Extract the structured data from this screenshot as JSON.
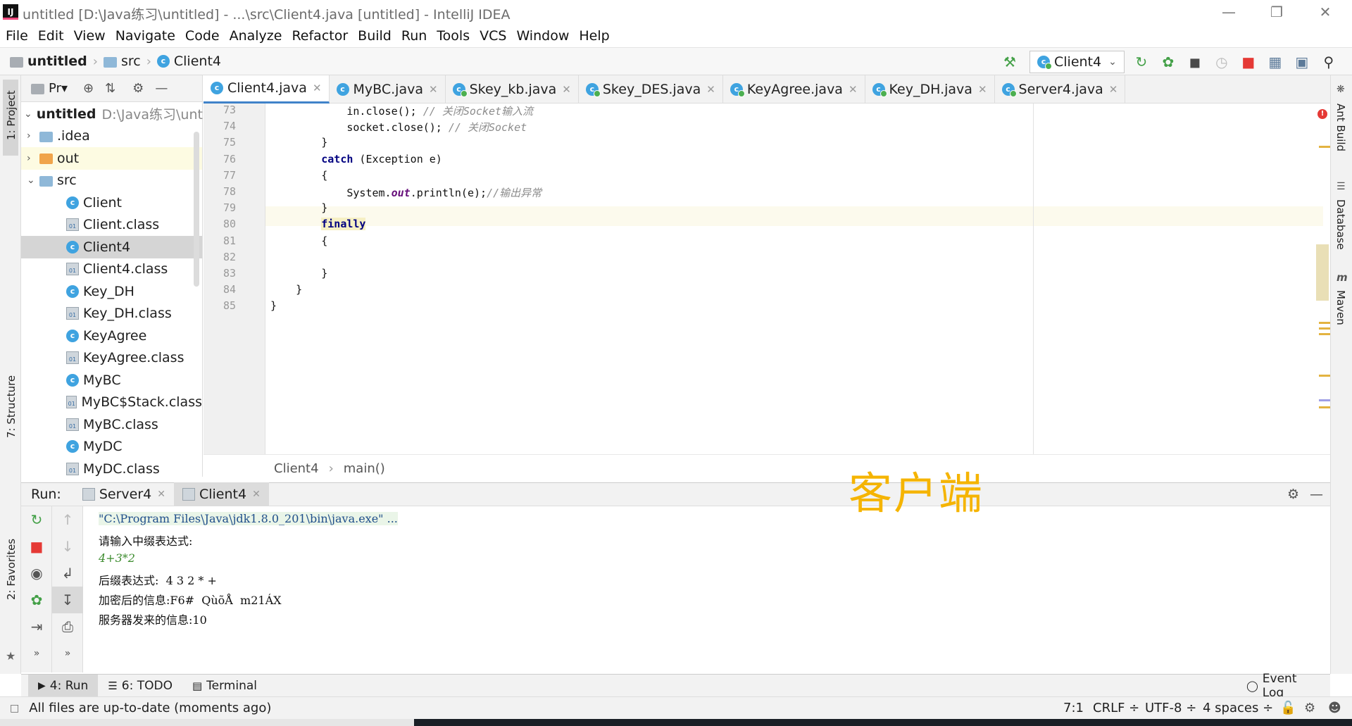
{
  "window": {
    "title": "untitled [D:\\Java练习\\untitled] - ...\\src\\Client4.java [untitled] - IntelliJ IDEA",
    "logo": "IJ"
  },
  "menu": [
    "File",
    "Edit",
    "View",
    "Navigate",
    "Code",
    "Analyze",
    "Refactor",
    "Build",
    "Run",
    "Tools",
    "VCS",
    "Window",
    "Help"
  ],
  "navbar": {
    "crumbs": [
      "untitled",
      "src",
      "Client4"
    ],
    "run_config": "Client4"
  },
  "left_stripe": {
    "project": "1: Project",
    "structure": "7: Structure",
    "favorites": "2: Favorites"
  },
  "right_stripe": {
    "ant": "Ant Build",
    "database": "Database",
    "maven": "Maven"
  },
  "project_panel": {
    "header": "Pr▾",
    "root": {
      "name": "untitled",
      "path": "D:\\Java练习\\untitl"
    },
    "items": [
      {
        "label": ".idea",
        "kind": "folder",
        "level": 1,
        "arrow": "›"
      },
      {
        "label": "out",
        "kind": "folder-orange",
        "level": 1,
        "arrow": "›"
      },
      {
        "label": "src",
        "kind": "folder",
        "level": 1,
        "arrow": "⌄"
      },
      {
        "label": "Client",
        "kind": "class",
        "level": 2
      },
      {
        "label": "Client.class",
        "kind": "classfile",
        "level": 2
      },
      {
        "label": "Client4",
        "kind": "class",
        "level": 2
      },
      {
        "label": "Client4.class",
        "kind": "classfile",
        "level": 2
      },
      {
        "label": "Key_DH",
        "kind": "class",
        "level": 2
      },
      {
        "label": "Key_DH.class",
        "kind": "classfile",
        "level": 2
      },
      {
        "label": "KeyAgree",
        "kind": "class",
        "level": 2
      },
      {
        "label": "KeyAgree.class",
        "kind": "classfile",
        "level": 2
      },
      {
        "label": "MyBC",
        "kind": "class",
        "level": 2
      },
      {
        "label": "MyBC$Stack.class",
        "kind": "classfile",
        "level": 2
      },
      {
        "label": "MyBC.class",
        "kind": "classfile",
        "level": 2
      },
      {
        "label": "MyDC",
        "kind": "class",
        "level": 2
      },
      {
        "label": "MyDC.class",
        "kind": "classfile",
        "level": 2
      }
    ]
  },
  "editor_tabs": [
    "Client4.java",
    "MyBC.java",
    "Skey_kb.java",
    "Skey_DES.java",
    "KeyAgree.java",
    "Key_DH.java",
    "Server4.java"
  ],
  "editor": {
    "lines": [
      {
        "n": "73",
        "code": "            in.close(); ",
        "comment": "// 关闭Socket输入流"
      },
      {
        "n": "74",
        "code": "            socket.close(); ",
        "comment": "// 关闭Socket"
      },
      {
        "n": "75",
        "code": "        }"
      },
      {
        "n": "76",
        "kw": "catch",
        "code": " (Exception e)"
      },
      {
        "n": "77",
        "code": "        {"
      },
      {
        "n": "78",
        "code": "            System.",
        "field": "out",
        "code2": ".println(e);",
        "comment": "//输出异常"
      },
      {
        "n": "79",
        "code": "        }"
      },
      {
        "n": "80",
        "kw": "finally",
        "code": ""
      },
      {
        "n": "81",
        "code": "        {"
      },
      {
        "n": "82",
        "code": ""
      },
      {
        "n": "83",
        "code": "        }"
      },
      {
        "n": "84",
        "code": "    }"
      },
      {
        "n": "85",
        "code": "}"
      }
    ],
    "breadcrumb": [
      "Client4",
      "main()"
    ]
  },
  "run_panel": {
    "label": "Run:",
    "tabs": [
      "Server4",
      "Client4"
    ],
    "console": [
      "\"C:\\Program Files\\Java\\jdk1.8.0_201\\bin\\java.exe\" ...",
      "请输入中缀表达式:",
      "4+3*2",
      "后缀表达式:  4 3 2 * +",
      "加密后的信息:F6#  QùõÅ  m21ÁX",
      "服务器发来的信息:10"
    ]
  },
  "overlay_label": "客户端",
  "tool_buttons": [
    "4: Run",
    "6: TODO",
    "Terminal"
  ],
  "event_log": "Event Log",
  "status": {
    "message": "All files are up-to-date (moments ago)",
    "position": "7:1",
    "line_sep": "CRLF ÷",
    "encoding": "UTF-8 ÷",
    "indent": "4 spaces ÷"
  },
  "colors": {
    "accent": "#4083c9",
    "overlay": "#f5b400",
    "stop": "#e53935",
    "run": "#43a047"
  }
}
